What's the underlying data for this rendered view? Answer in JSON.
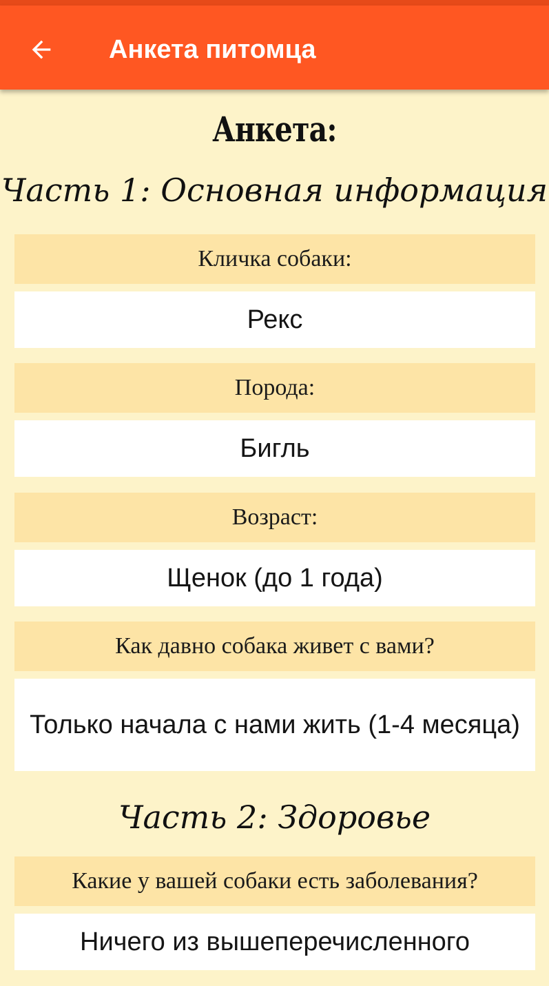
{
  "app_bar": {
    "title": "Анкета питомца",
    "back_icon": "arrow-left-icon",
    "color": "#ff5722",
    "status_bar_color": "#e64a19"
  },
  "form": {
    "title": "Анкета:",
    "background": "#fdf3c9",
    "question_background": "#fde4a6",
    "sections": [
      {
        "title": "Часть 1: Основная информация",
        "items": [
          {
            "question": "Кличка собаки:",
            "answer": "Рекс"
          },
          {
            "question": "Порода:",
            "answer": "Бигль"
          },
          {
            "question": "Возраст:",
            "answer": "Щенок (до 1 года)"
          },
          {
            "question": "Как давно собака живет с вами?",
            "answer": "Только начала с нами жить (1-4 месяца)"
          }
        ]
      },
      {
        "title": "Часть 2: Здоровье",
        "items": [
          {
            "question": "Какие у вашей собаки есть заболевания?",
            "answer": "Ничего из вышеперечисленного"
          }
        ]
      }
    ]
  }
}
